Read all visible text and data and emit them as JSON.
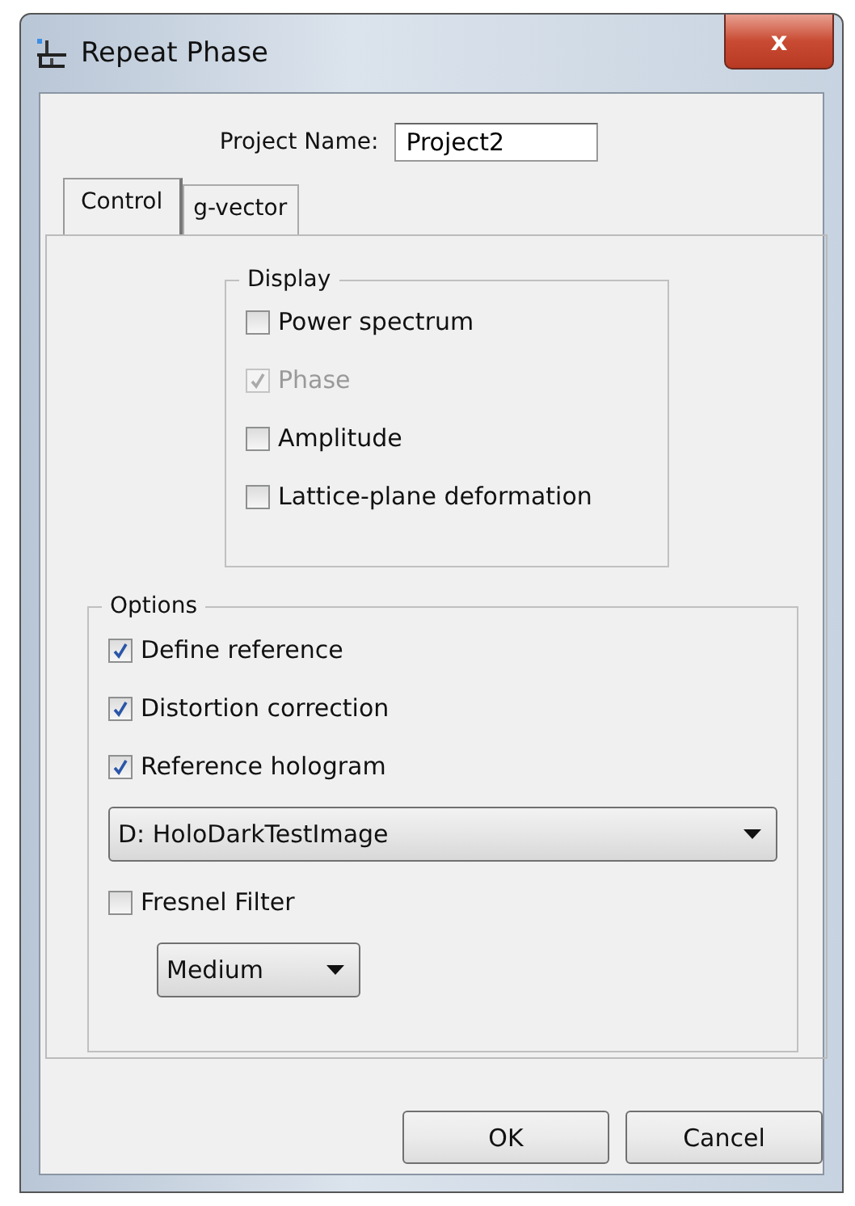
{
  "window": {
    "title": "Repeat Phase",
    "close": "x"
  },
  "project_name": {
    "label": "Project Name:",
    "value": "Project2"
  },
  "tabs": [
    {
      "label": "Control",
      "selected": true
    },
    {
      "label": "g-vector",
      "selected": false
    }
  ],
  "display": {
    "title": "Display",
    "items": [
      {
        "label": "Power spectrum",
        "checked": false,
        "disabled": false
      },
      {
        "label": "Phase",
        "checked": true,
        "disabled": true
      },
      {
        "label": "Amplitude",
        "checked": false,
        "disabled": false
      },
      {
        "label": "Lattice-plane deformation",
        "checked": false,
        "disabled": false
      }
    ]
  },
  "options": {
    "title": "Options",
    "items": [
      {
        "kind": "checkbox",
        "label": "Define reference",
        "checked": true
      },
      {
        "kind": "checkbox",
        "label": "Distortion correction",
        "checked": true
      },
      {
        "kind": "checkbox",
        "label": "Reference hologram",
        "checked": true
      },
      {
        "kind": "dropdown",
        "value": "D: HoloDarkTestImage",
        "wide": true
      },
      {
        "kind": "checkbox",
        "label": "Fresnel Filter",
        "checked": false
      },
      {
        "kind": "dropdown",
        "value": "Medium",
        "wide": false
      }
    ]
  },
  "buttons": [
    "OK",
    "Cancel"
  ]
}
